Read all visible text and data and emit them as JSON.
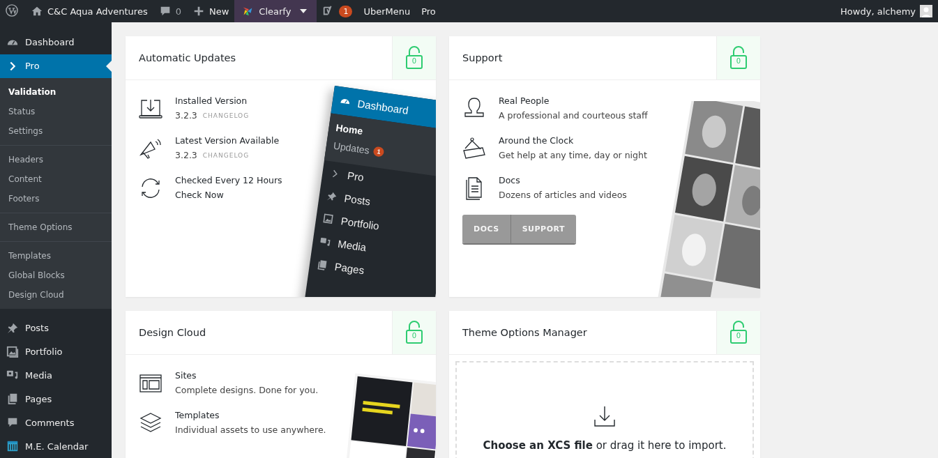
{
  "admin_bar": {
    "site_name": "C&C Aqua Adventures",
    "comments_count": "0",
    "new_label": "New",
    "clearfy_label": "Clearfy",
    "yoast_badge": "1",
    "links": [
      "UberMenu",
      "Pro"
    ],
    "greeting": "Howdy, alchemy"
  },
  "sidebar": {
    "top_items": [
      {
        "label": "Dashboard",
        "selected": false
      },
      {
        "label": "Pro",
        "selected": true
      }
    ],
    "submenu": [
      [
        {
          "label": "Validation",
          "selected": true
        },
        {
          "label": "Status",
          "selected": false
        },
        {
          "label": "Settings",
          "selected": false
        }
      ],
      [
        {
          "label": "Headers",
          "selected": false
        },
        {
          "label": "Content",
          "selected": false
        },
        {
          "label": "Footers",
          "selected": false
        }
      ],
      [
        {
          "label": "Theme Options",
          "selected": false
        }
      ],
      [
        {
          "label": "Templates",
          "selected": false
        },
        {
          "label": "Global Blocks",
          "selected": false
        },
        {
          "label": "Design Cloud",
          "selected": false
        }
      ]
    ],
    "bottom_items": [
      {
        "label": "Posts",
        "selected": false
      },
      {
        "label": "Portfolio",
        "selected": false
      },
      {
        "label": "Media",
        "selected": false
      },
      {
        "label": "Pages",
        "selected": false
      },
      {
        "label": "Comments",
        "selected": false
      },
      {
        "label": "M.E. Calendar",
        "selected": false
      }
    ]
  },
  "cards": [
    {
      "title": "Automatic Updates",
      "lock_count": "0",
      "kind": "features",
      "items": [
        {
          "title": "Installed Version",
          "version": "3.2.3",
          "link": "CHANGELOG"
        },
        {
          "title": "Latest Version Available",
          "version": "3.2.3",
          "link": "CHANGELOG"
        },
        {
          "title": "Checked Every 12 Hours",
          "action": "Check Now"
        }
      ],
      "preview_menu": {
        "header": "Dashboard",
        "submenu": [
          {
            "label": "Home",
            "selected": true
          },
          {
            "label": "Updates",
            "selected": false,
            "badge": "1"
          }
        ],
        "items": [
          "Pro",
          "Posts",
          "Portfolio",
          "Media",
          "Pages"
        ]
      }
    },
    {
      "title": "Support",
      "lock_count": "0",
      "kind": "features",
      "items": [
        {
          "title": "Real People",
          "text": "A professional and courteous staff"
        },
        {
          "title": "Around the Clock",
          "text": "Get help at any time, day or night"
        },
        {
          "title": "Docs",
          "text": "Dozens of articles and videos"
        }
      ],
      "buttons": [
        "DOCS",
        "SUPPORT"
      ]
    },
    {
      "title": "Design Cloud",
      "lock_count": "0",
      "kind": "features",
      "items": [
        {
          "title": "Sites",
          "text": "Complete designs. Done for you."
        },
        {
          "title": "Templates",
          "text": "Individual assets to use anywhere."
        }
      ]
    },
    {
      "title": "Theme Options Manager",
      "lock_count": "0",
      "kind": "import",
      "import_text": "**Choose an XCS file** or drag it here to import."
    }
  ]
}
